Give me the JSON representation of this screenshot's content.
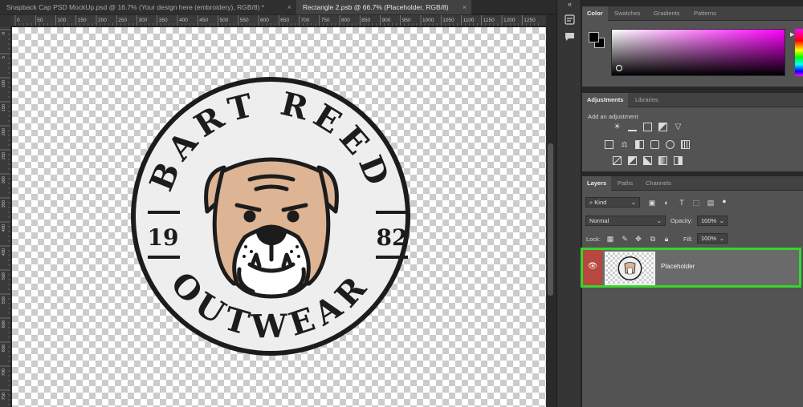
{
  "tabs": [
    {
      "title": "Snapback Cap PSD MockUp.psd @ 16.7% (Your design here (embroidery), RGB/8) *",
      "close": "×"
    },
    {
      "title": "Rectangle 2.psb @ 66.7% (Placeholder, RGB/8)",
      "close": "×"
    }
  ],
  "ruler": {
    "top_ticks": [
      "0",
      "50",
      "100",
      "150",
      "200",
      "250",
      "300",
      "350",
      "400",
      "450",
      "500",
      "550",
      "600",
      "650",
      "700",
      "750",
      "800",
      "850",
      "900",
      "950",
      "1000",
      "1050",
      "1100",
      "1150",
      "1200",
      "1250"
    ],
    "left_ticks": [
      "0",
      "5",
      "100",
      "150",
      "200",
      "250",
      "300",
      "350",
      "400",
      "450",
      "500",
      "550",
      "600",
      "650",
      "700",
      "750"
    ]
  },
  "artwork": {
    "top_text": "BART REED",
    "bottom_text": "OUTWEAR",
    "year_left": "19",
    "year_right": "82",
    "colors": {
      "outline": "#1c1c1c",
      "badge_fill": "#eeeeee",
      "fur": "#ddb494",
      "muzzle": "#ffffff"
    }
  },
  "color_panel": {
    "tabs": [
      "Color",
      "Swatches",
      "Gradients",
      "Patterns"
    ],
    "active_tab": "Color",
    "foreground": "#000000",
    "background": "#000000",
    "field_hue": "#ff00ff"
  },
  "adjustments_panel": {
    "tabs": [
      "Adjustments",
      "Libraries"
    ],
    "active_tab": "Adjustments",
    "title": "Add an adjustment"
  },
  "layers_panel": {
    "tabs": [
      "Layers",
      "Paths",
      "Channels"
    ],
    "active_tab": "Layers",
    "filter_kind": "Kind",
    "blend_mode": "Normal",
    "opacity_label": "Opacity:",
    "opacity": "100%",
    "lock_label": "Lock:",
    "fill_label": "Fill:",
    "fill": "100%",
    "layers": [
      {
        "name": "Placeholder",
        "visible": true,
        "selected": true
      }
    ],
    "highlight_color": "#36d62a"
  }
}
